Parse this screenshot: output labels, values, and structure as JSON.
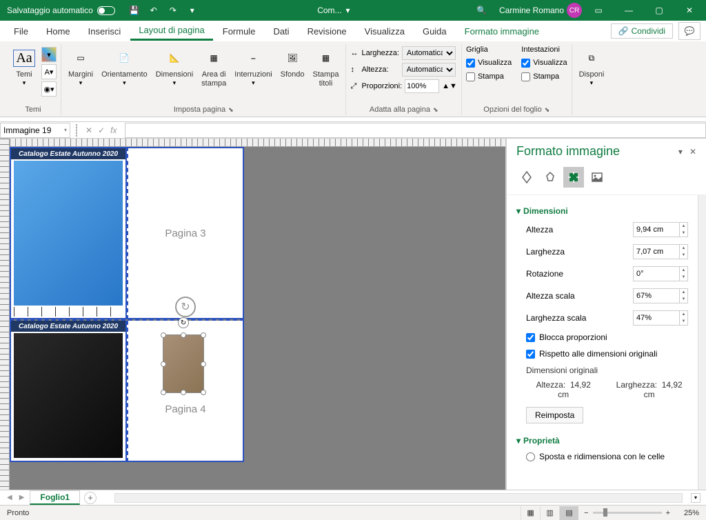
{
  "titlebar": {
    "autosave": "Salvataggio automatico",
    "doc": "Com...",
    "search_icon": "search",
    "user": "Carmine Romano",
    "initials": "CR"
  },
  "tabs": {
    "file": "File",
    "home": "Home",
    "insert": "Inserisci",
    "layout": "Layout di pagina",
    "formulas": "Formule",
    "data": "Dati",
    "review": "Revisione",
    "view": "Visualizza",
    "help": "Guida",
    "pictureformat": "Formato immagine",
    "share": "Condividi"
  },
  "ribbon": {
    "themes": {
      "label": "Temi",
      "btn": "Temi"
    },
    "pagesetup": {
      "margins": "Margini",
      "orientation": "Orientamento",
      "size": "Dimensioni",
      "printarea": "Area di\nstampa",
      "breaks": "Interruzioni",
      "background": "Sfondo",
      "printtitles": "Stampa\ntitoli",
      "label": "Imposta pagina"
    },
    "scaletofit": {
      "width": "Larghezza:",
      "height": "Altezza:",
      "scale": "Proporzioni:",
      "auto": "Automatica",
      "scaleval": "100%",
      "label": "Adatta alla pagina"
    },
    "sheetoptions": {
      "gridlines": "Griglia",
      "headings": "Intestazioni",
      "view": "Visualizza",
      "print": "Stampa",
      "label": "Opzioni del foglio"
    },
    "arrange": {
      "btn": "Disponi"
    }
  },
  "namebox": "Immagine 19",
  "pages": {
    "header": "Catalogo Estate Autunno 2020",
    "p3": "Pagina 3",
    "p4": "Pagina 4"
  },
  "pane": {
    "title": "Formato immagine",
    "dimensions": "Dimensioni",
    "height": "Altezza",
    "width": "Larghezza",
    "rotation": "Rotazione",
    "scaleheight": "Altezza scala",
    "scalewidth": "Larghezza scala",
    "lockaspect": "Blocca proporzioni",
    "relativeorig": "Rispetto alle dimensioni originali",
    "origsize": "Dimensioni originali",
    "h_val": "9,94 cm",
    "w_val": "7,07 cm",
    "r_val": "0°",
    "sh_val": "67%",
    "sw_val": "47%",
    "orig_h_lbl": "Altezza:",
    "orig_w_lbl": "Larghezza:",
    "orig_h": "14,92 cm",
    "orig_w": "14,92 cm",
    "reset": "Reimposta",
    "properties": "Proprietà",
    "movesize": "Sposta e ridimensiona con le celle"
  },
  "sheet": "Foglio1",
  "status": {
    "ready": "Pronto",
    "zoom": "25%"
  }
}
